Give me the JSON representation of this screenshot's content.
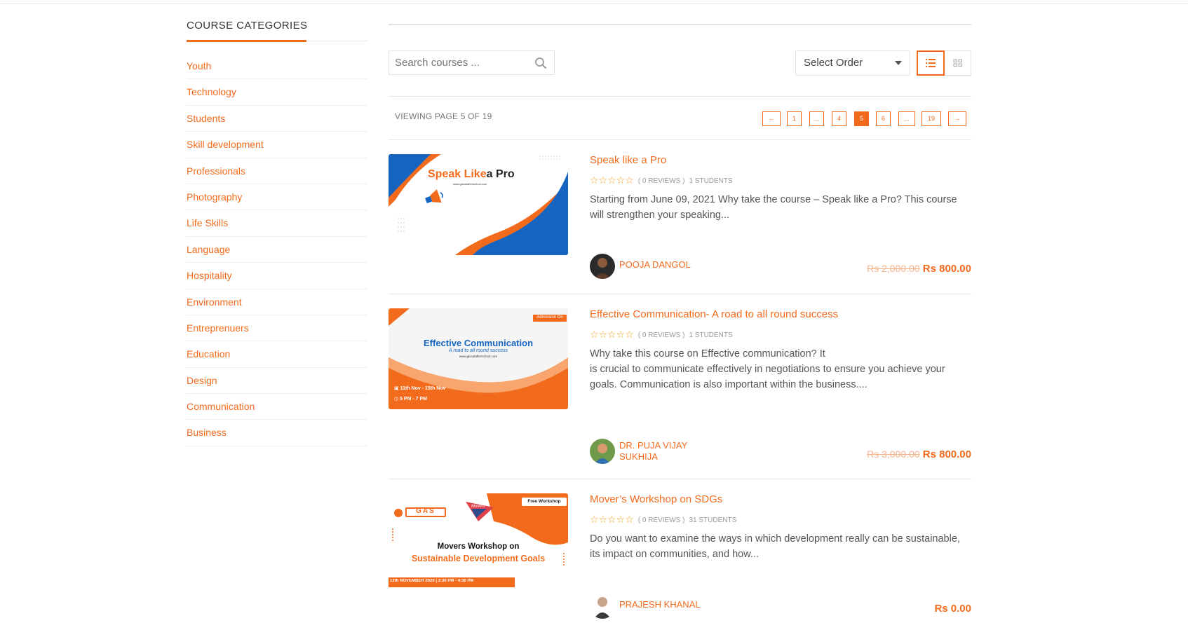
{
  "sidebar": {
    "title": "COURSE CATEGORIES",
    "categories": [
      "Youth",
      "Technology",
      "Students",
      "Skill development",
      "Professionals",
      "Photography",
      "Life Skills",
      "Language",
      "Hospitality",
      "Environment",
      "Entreprenuers",
      "Education",
      "Design",
      "Communication",
      "Business"
    ]
  },
  "toolbar": {
    "search_placeholder": "Search courses ...",
    "order_label": "Select Order"
  },
  "paging": {
    "text": "VIEWING PAGE 5 OF 19",
    "prev": "←",
    "next": "→",
    "pages": [
      "1",
      "...",
      "4",
      "5",
      "6",
      "...",
      "19"
    ],
    "current": "5"
  },
  "courses": [
    {
      "title": "Speak like a Pro",
      "stars": "☆☆☆☆☆",
      "reviews": "( 0 REVIEWS )",
      "students": "1 STUDENTS",
      "description": "Starting from June 09, 2021 Why take the course – Speak like a Pro? This course will strengthen your speaking...",
      "author": "POOJA DANGOL",
      "old_price": "Rs 2,000.00",
      "price": "Rs 800.00",
      "thumb": {
        "heading_a": "Speak Like",
        "heading_b": "a Pro",
        "url": "www.glocalafterschool.com"
      }
    },
    {
      "title": "Effective Communication- A road to all round success",
      "stars": "☆☆☆☆☆",
      "reviews": "( 0 REVIEWS )",
      "students": "1 STUDENTS",
      "description": "Why take this course on Effective communication? It\nis crucial to communicate effectively in negotiations to ensure you achieve your goals. Communication is also important within the business....",
      "author": "DR. PUJA VIJAY SUKHIJA",
      "old_price": "Rs 3,000.00",
      "price": "Rs 800.00",
      "thumb": {
        "badge": "Admission On",
        "heading": "Effective Communication",
        "subheading": "A road to all round success",
        "url": "www.glocalafterschool.com",
        "date": "11th Nov - 15th Nov",
        "time": "5 PM - 7 PM"
      }
    },
    {
      "title": "Mover’s Workshop on SDGs",
      "stars": "☆☆☆☆☆",
      "reviews": "( 0 REVIEWS )",
      "students": "31 STUDENTS",
      "description": "Do you want to examine the ways in which development really can be sustainable, its impact on communities, and how...",
      "author": "PRAJESH KHANAL",
      "old_price": "",
      "price": "Rs 0.00",
      "thumb": {
        "badge": "Free Workshop",
        "logo": "GAS",
        "logo2": "Movers",
        "heading_a": "Movers Workshop on",
        "heading_b": "Sustainable Development Goals",
        "footer": "13th NOVEMBER 2020 | 2:30 PM - 4:30 PM"
      }
    }
  ],
  "colors": {
    "accent": "#f26b1d",
    "blue": "#1565c0",
    "old_price": "#f6b48c",
    "star": "#f0a020"
  },
  "icons": {
    "search": "search-icon",
    "list_view": "list-view-icon",
    "grid_view": "grid-view-icon",
    "dropdown": "caret-down-icon"
  }
}
